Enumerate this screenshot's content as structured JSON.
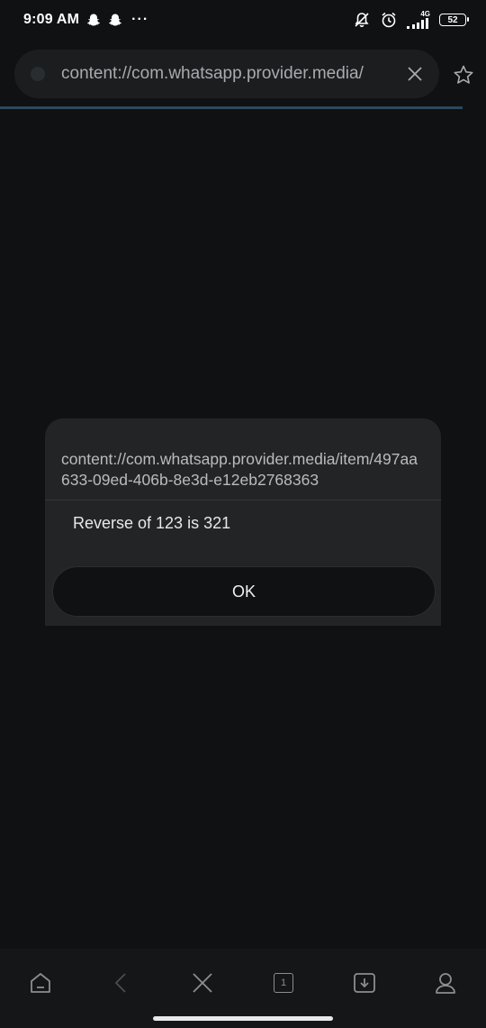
{
  "status_bar": {
    "time": "9:09 AM",
    "dots": "···",
    "network_type": "4G",
    "battery_level": "52"
  },
  "browser": {
    "url": "content://com.whatsapp.provider.media/",
    "tab_count": "1"
  },
  "dialog": {
    "title": "content://com.whatsapp.provider.media/item/497aa633-09ed-406b-8e3d-e12eb2768363",
    "message": "Reverse of 123 is 321",
    "ok_label": "OK"
  },
  "icons": {
    "status": [
      "snapchat-ghost-icon",
      "snapchat-ghost-icon",
      "more-dots-icon",
      "notifications-off-icon",
      "alarm-icon",
      "signal-icon",
      "battery-icon"
    ],
    "toolbar": [
      "home-icon",
      "back-icon",
      "close-icon",
      "tabs-icon",
      "downloads-icon",
      "profile-icon"
    ]
  }
}
